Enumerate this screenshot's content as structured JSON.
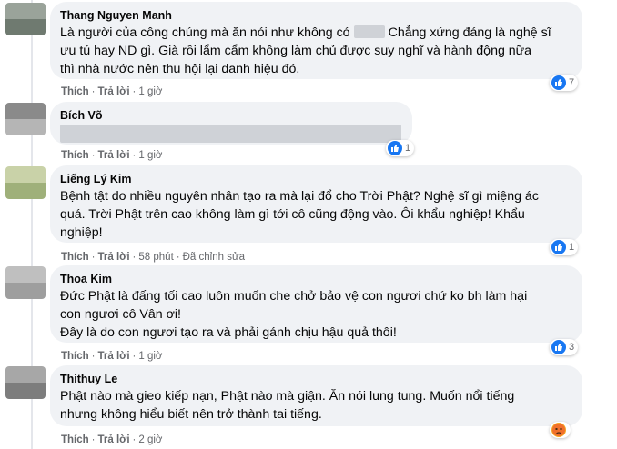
{
  "actions": {
    "like": "Thích",
    "reply": "Trả lời",
    "separator": "·"
  },
  "comments": [
    {
      "author": "Thang Nguyen Manh",
      "text_before": "Là người của công chúng mà ăn nói như không có",
      "text_after": "Chẳng xứng đáng là nghệ sĩ\nưu tú hay ND gì. Già rồi lẩm cẩm không làm chủ được suy nghĩ và hành động nữa\nthì nhà nước nên thu hội lại danh hiệu đó.",
      "time": "1 giờ",
      "reaction": {
        "icon": "like-icon",
        "count": "7"
      },
      "avatar_colors": [
        "#9aa39a",
        "#6f7a70"
      ]
    },
    {
      "author": "Bích Võ",
      "time": "1 giờ",
      "reaction": {
        "icon": "like-icon",
        "count": "1"
      },
      "avatar_colors": [
        "#8a8a8a",
        "#b5b5b5"
      ]
    },
    {
      "author": "Liếng Lý Kim",
      "text": "Bệnh tật do nhiều nguyên nhân tạo ra mà lại đổ cho Trời Phật? Nghệ sĩ gì miệng ác\nquá. Trời Phật trên cao không làm gì tới cô cũng động vào. Ôi khẩu nghiệp! Khẩu\nnghiệp!",
      "time": "58 phút",
      "edited": "Đã chỉnh sửa",
      "reaction": {
        "icon": "like-icon",
        "count": "1"
      },
      "avatar_colors": [
        "#c9d2a8",
        "#9fb07a"
      ]
    },
    {
      "author": "Thoa Kim",
      "text": "Đức Phật là đấng tối cao luôn muốn che chở bảo vệ con ngươi chứ ko bh làm hại\ncon ngươi cô Vân ơi!\nĐây là do con ngươi tạo ra và phải gánh chịu hậu quả thôi!",
      "time": "1 giờ",
      "reaction": {
        "icon": "like-icon",
        "count": "3"
      },
      "avatar_colors": [
        "#bfbfbf",
        "#9e9e9e"
      ]
    },
    {
      "author": "Thithuy Le",
      "text": "Phật nào mà gieo kiếp nạn, Phật nào mà giận. Ăn nói lung tung. Muốn nổi tiếng\nnhưng không hiểu biết nên trở thành tai tiếng.",
      "time": "2 giờ",
      "reaction": {
        "icon": "angry-icon",
        "count": ""
      },
      "avatar_colors": [
        "#a7a7a7",
        "#7d7d7d"
      ]
    }
  ]
}
